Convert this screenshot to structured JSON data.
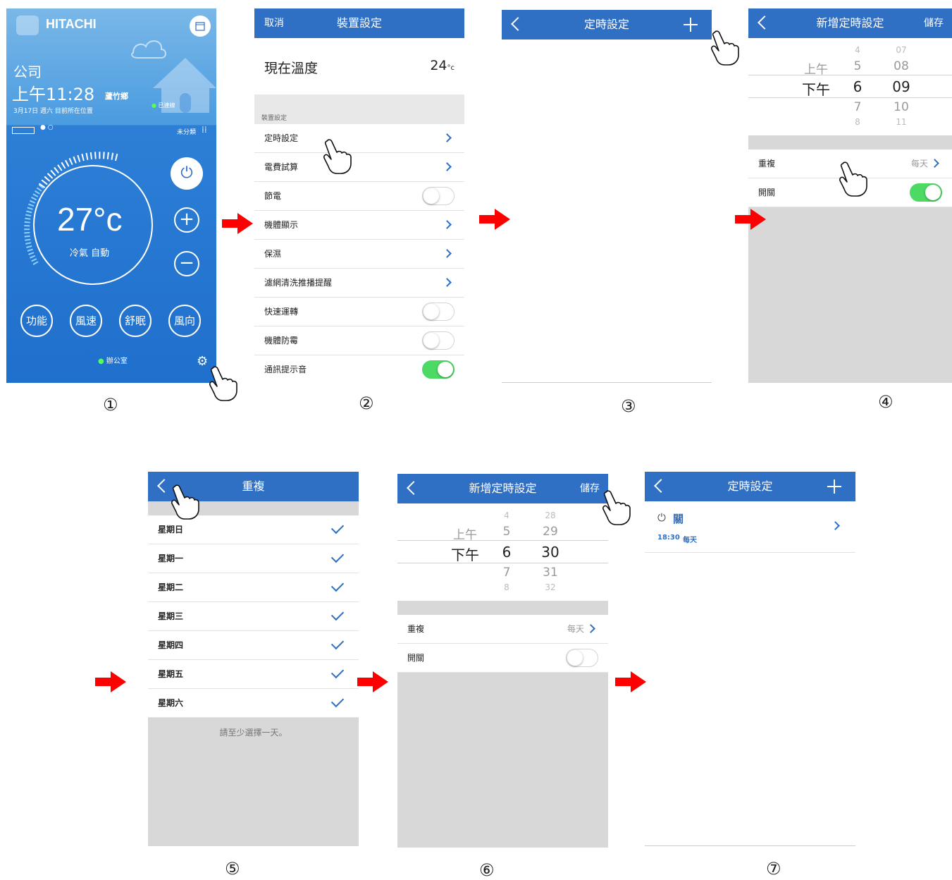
{
  "screen1": {
    "brand": "HITACHI",
    "location": "公司",
    "time": "上午11:28",
    "city": "蘆竹鄉",
    "date_line": "3月17日 週六  目前所在位置",
    "connected": "已連線",
    "category": "未分類",
    "temperature": "27°c",
    "mode": "冷氣 自動",
    "buttons": [
      "功能",
      "風速",
      "舒眠",
      "風向"
    ],
    "room": "辦公室"
  },
  "screen2": {
    "cancel": "取消",
    "title": "裝置設定",
    "current_temp_label": "現在溫度",
    "current_temp_value": "24",
    "current_temp_unit": "°c",
    "section": "裝置設定",
    "rows": [
      {
        "label": "定時設定",
        "type": "arrow"
      },
      {
        "label": "電費試算",
        "type": "arrow"
      },
      {
        "label": "節電",
        "type": "toggle",
        "on": false
      },
      {
        "label": "機體顯示",
        "type": "arrow"
      },
      {
        "label": "保濕",
        "type": "arrow"
      },
      {
        "label": "濾網清洗推播提醒",
        "type": "arrow"
      },
      {
        "label": "快速運轉",
        "type": "toggle",
        "on": false
      },
      {
        "label": "機體防霉",
        "type": "toggle",
        "on": false
      },
      {
        "label": "通訊提示音",
        "type": "toggle",
        "on": true
      }
    ]
  },
  "screen3": {
    "title": "定時設定"
  },
  "screen4": {
    "title": "新增定時設定",
    "save": "儲存",
    "ampm": [
      "上午",
      "下午"
    ],
    "hours": [
      "4",
      "5",
      "6",
      "7",
      "8"
    ],
    "minutes": [
      "07",
      "08",
      "09",
      "10",
      "11"
    ],
    "repeat_label": "重複",
    "repeat_value": "每天",
    "switch_label": "開關",
    "switch_on": true
  },
  "screen5": {
    "title": "重複",
    "days": [
      "星期日",
      "星期一",
      "星期二",
      "星期三",
      "星期四",
      "星期五",
      "星期六"
    ],
    "hint": "請至少選擇一天。"
  },
  "screen6": {
    "title": "新增定時設定",
    "save": "儲存",
    "ampm": [
      "上午",
      "下午"
    ],
    "hours": [
      "4",
      "5",
      "6",
      "7",
      "8"
    ],
    "minutes": [
      "28",
      "29",
      "30",
      "31",
      "32"
    ],
    "repeat_label": "重複",
    "repeat_value": "每天",
    "switch_label": "開關",
    "switch_on": false
  },
  "screen7": {
    "title": "定時設定",
    "item_label": "關",
    "item_time": "18:30",
    "item_repeat": "每天"
  },
  "steps": [
    "①",
    "②",
    "③",
    "④",
    "⑤",
    "⑥",
    "⑦"
  ],
  "colors": {
    "header": "#2f6fc4",
    "arrow": "#ff0000",
    "toggle_on": "#4cd964",
    "grey_area": "#d8d8d8"
  }
}
